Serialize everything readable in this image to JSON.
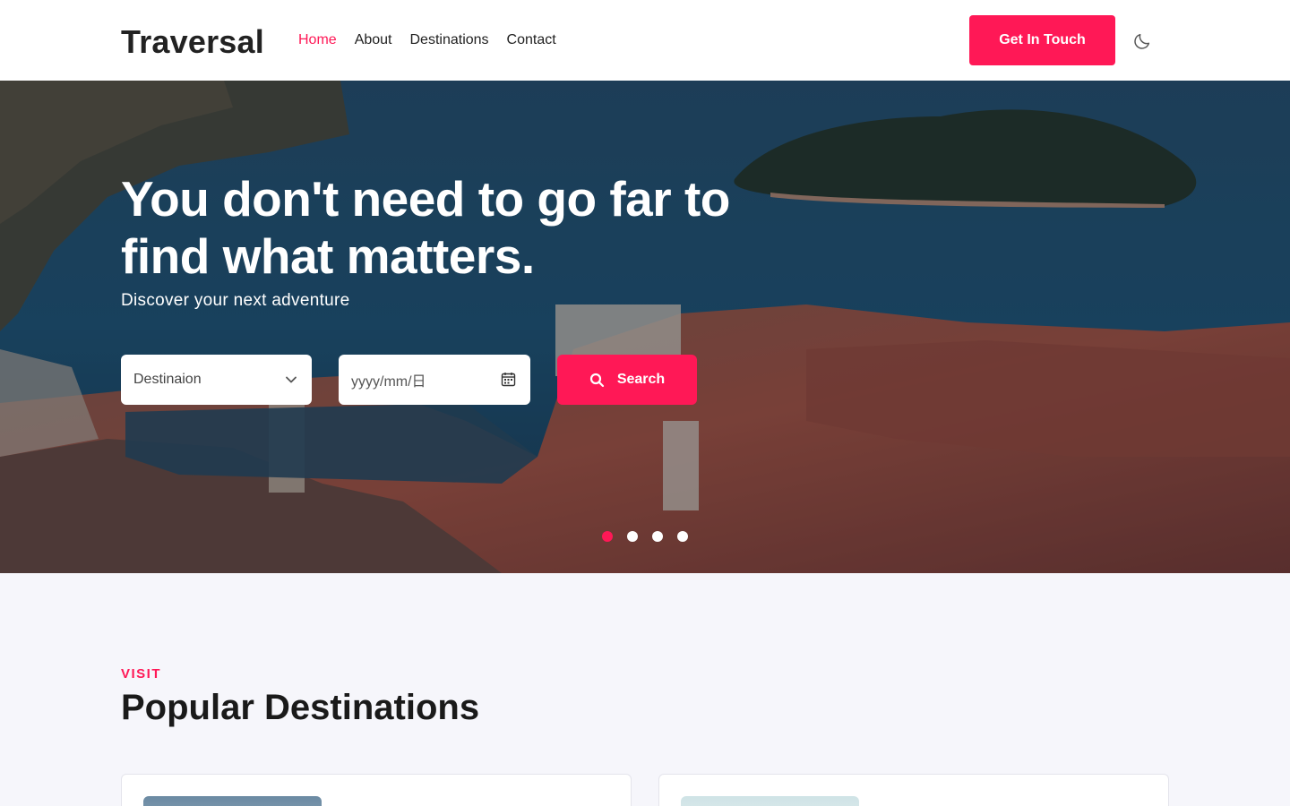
{
  "header": {
    "logo": "Traversal",
    "nav": [
      {
        "label": "Home",
        "active": true
      },
      {
        "label": "About",
        "active": false
      },
      {
        "label": "Destinations",
        "active": false
      },
      {
        "label": "Contact",
        "active": false
      }
    ],
    "cta_label": "Get In Touch",
    "theme_icon": "moon-icon"
  },
  "hero": {
    "title_line1": "You don't need to go far to",
    "title_line2": "find what matters.",
    "subtitle": "Discover your next adventure",
    "search": {
      "destination_placeholder": "Destinaion",
      "date_placeholder": "yyyy/mm/日",
      "search_label": "Search"
    },
    "slides_total": 4,
    "active_slide": 1
  },
  "popular": {
    "eyebrow": "VISIT",
    "title": "Popular Destinations"
  },
  "colors": {
    "accent": "#ff1856",
    "header_bg": "#ffffff",
    "section_bg": "#f6f6fb"
  }
}
